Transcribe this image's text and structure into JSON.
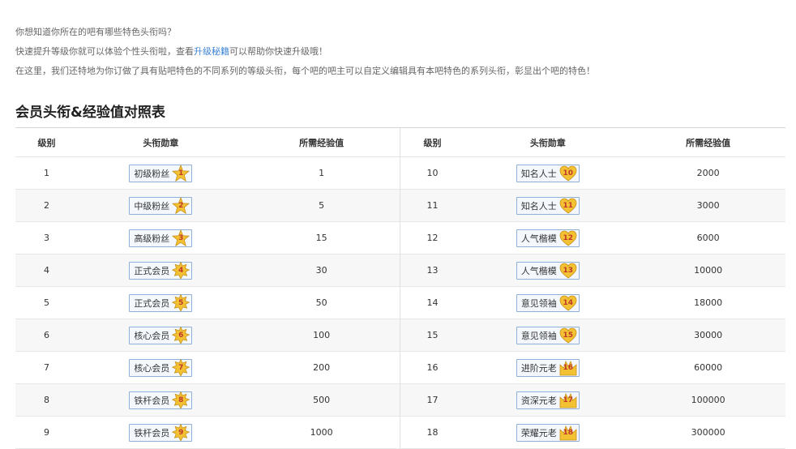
{
  "intro": {
    "line1": "你想知道你所在的吧有哪些特色头衔吗？",
    "line2_pre": "快速提升等级你就可以体验个性头衔啦，查看",
    "line2_link": "升级秘籍",
    "line2_post": "可以帮助你快速升级哦！",
    "line3": "在这里，我们还特地为你订做了具有贴吧特色的不同系列的等级头衔，每个吧的吧主可以自定义编辑具有本吧特色的系列头衔，彰显出个吧的特色！"
  },
  "title": "会员头衔&经验值对照表",
  "headers": {
    "level": "级别",
    "badge": "头衔勋章",
    "exp": "所需经验值"
  },
  "colors": {
    "link": "#3d84d8",
    "badge_border": "#8fb1d8",
    "icon_gold": "#f2c233",
    "icon_number": "#c0392b"
  },
  "rows": [
    {
      "l": {
        "level": "1",
        "title": "初级粉丝",
        "icon": "star-icon",
        "num": "1",
        "exp": "1"
      },
      "r": {
        "level": "10",
        "title": "知名人士",
        "icon": "heart-icon",
        "num": "10",
        "exp": "2000"
      }
    },
    {
      "l": {
        "level": "2",
        "title": "中级粉丝",
        "icon": "star-icon",
        "num": "2",
        "exp": "5"
      },
      "r": {
        "level": "11",
        "title": "知名人士",
        "icon": "heart-icon",
        "num": "11",
        "exp": "3000"
      }
    },
    {
      "l": {
        "level": "3",
        "title": "高级粉丝",
        "icon": "star-icon",
        "num": "3",
        "exp": "15"
      },
      "r": {
        "level": "12",
        "title": "人气楷模",
        "icon": "heart-icon",
        "num": "12",
        "exp": "6000"
      }
    },
    {
      "l": {
        "level": "4",
        "title": "正式会员",
        "icon": "starburst-icon",
        "num": "4",
        "exp": "30"
      },
      "r": {
        "level": "13",
        "title": "人气楷模",
        "icon": "heart-icon",
        "num": "13",
        "exp": "10000"
      }
    },
    {
      "l": {
        "level": "5",
        "title": "正式会员",
        "icon": "starburst-icon",
        "num": "5",
        "exp": "50"
      },
      "r": {
        "level": "14",
        "title": "意见领袖",
        "icon": "heart-icon",
        "num": "14",
        "exp": "18000"
      }
    },
    {
      "l": {
        "level": "6",
        "title": "核心会员",
        "icon": "starburst-icon",
        "num": "6",
        "exp": "100"
      },
      "r": {
        "level": "15",
        "title": "意见领袖",
        "icon": "heart-icon",
        "num": "15",
        "exp": "30000"
      }
    },
    {
      "l": {
        "level": "7",
        "title": "核心会员",
        "icon": "starburst-icon",
        "num": "7",
        "exp": "200"
      },
      "r": {
        "level": "16",
        "title": "进阶元老",
        "icon": "crown-icon",
        "num": "16",
        "exp": "60000"
      }
    },
    {
      "l": {
        "level": "8",
        "title": "铁杆会员",
        "icon": "starburst-icon",
        "num": "8",
        "exp": "500"
      },
      "r": {
        "level": "17",
        "title": "资深元老",
        "icon": "crown-icon",
        "num": "17",
        "exp": "100000"
      }
    },
    {
      "l": {
        "level": "9",
        "title": "铁杆会员",
        "icon": "starburst-icon",
        "num": "9",
        "exp": "1000"
      },
      "r": {
        "level": "18",
        "title": "荣耀元老",
        "icon": "crown-icon",
        "num": "18",
        "exp": "300000"
      }
    }
  ]
}
